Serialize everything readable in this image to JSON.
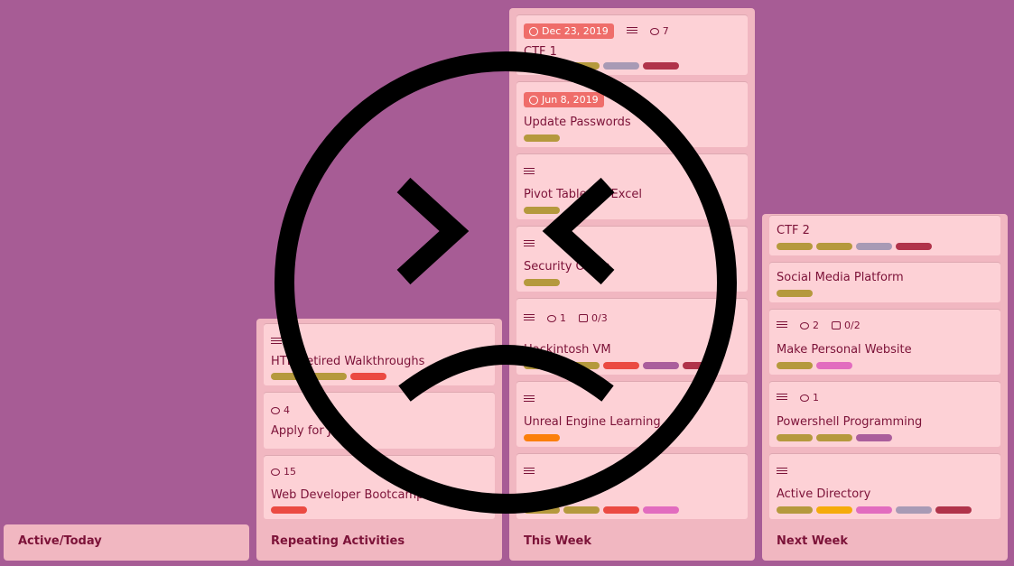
{
  "colors": {
    "background": "#a75c95",
    "list_bg": "#f1b7c1",
    "card_bg": "#fdd1d6",
    "label_olive": "#b5993d",
    "label_red": "#eb4a42",
    "label_grey": "#a89ab5",
    "label_crimson": "#b0334a",
    "label_purple": "#aa5e9c",
    "label_orange": "#fb7f0b",
    "label_pink": "#e26cbf",
    "label_yellow": "#f5ab0b",
    "due_red": "#ef6d6a"
  },
  "overlay_icon": "sad-face-icon",
  "lists": {
    "active": {
      "title": "Active/Today"
    },
    "repeating": {
      "title": "Repeating Activities",
      "cards": [
        {
          "title": "Web Developer Bootcamp",
          "comments": "15"
        },
        {
          "title": "Apply for Jobs",
          "comments": "4"
        },
        {
          "title": "HTB Retired Walkthroughs"
        }
      ]
    },
    "this_week": {
      "title": "This Week",
      "cards": [
        {
          "title": "Unreal Engine Learning"
        },
        {
          "title": "Hackintosh VM",
          "comments": "1",
          "checklist": "0/3"
        },
        {
          "title": "Security Onion"
        },
        {
          "title": "Pivot Tables in Excel"
        },
        {
          "title": "Update Passwords",
          "due": "Jun 8, 2019"
        },
        {
          "title": "CTF 1",
          "due": "Dec 23, 2019",
          "comments": "7"
        }
      ]
    },
    "next_week": {
      "title": "Next Week",
      "cards": [
        {
          "title": "Active Directory"
        },
        {
          "title": "Powershell Programming",
          "comments": "1"
        },
        {
          "title": "Make Personal Website",
          "comments": "2",
          "checklist": "0/2"
        },
        {
          "title": "Social Media Platform"
        },
        {
          "title": "CTF 2"
        }
      ]
    }
  }
}
